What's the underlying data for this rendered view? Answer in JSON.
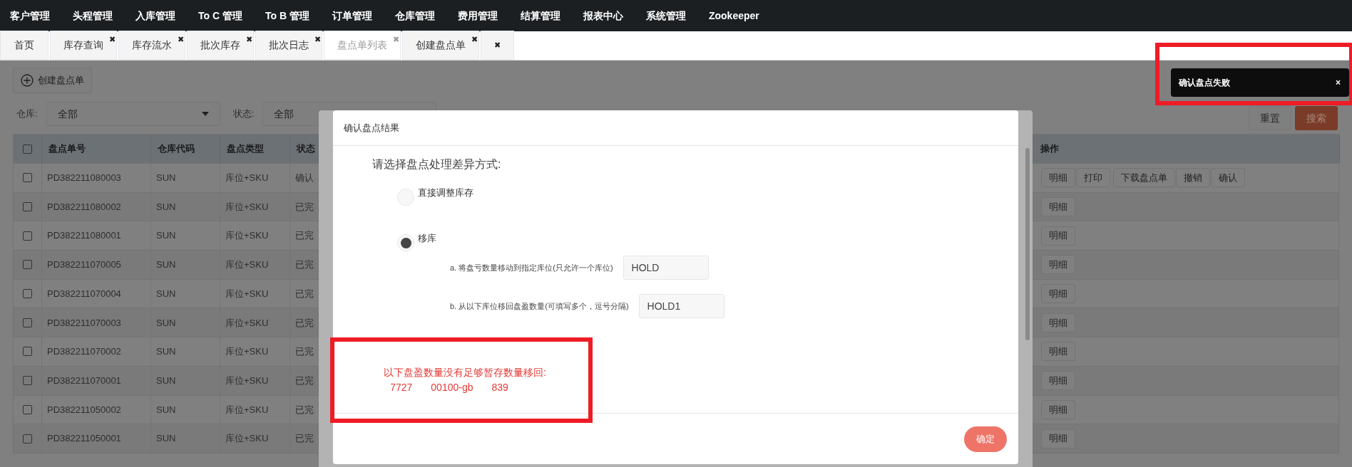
{
  "nav": [
    "客户管理",
    "头程管理",
    "入库管理",
    "To C 管理",
    "To B 管理",
    "订单管理",
    "仓库管理",
    "费用管理",
    "结算管理",
    "报表中心",
    "系统管理",
    "Zookeeper"
  ],
  "tabs": [
    {
      "label": "首页",
      "selected": false
    },
    {
      "label": "库存查询",
      "close": "✖",
      "selected": false
    },
    {
      "label": "库存流水",
      "close": "✖",
      "selected": false
    },
    {
      "label": "批次库存",
      "close": "✖",
      "selected": false
    },
    {
      "label": "批次日志",
      "close": "✖",
      "selected": false
    },
    {
      "label": "盘点单列表",
      "close": "✖",
      "selected": true
    },
    {
      "label": "创建盘点单",
      "close": "✖",
      "selected": false
    },
    {
      "close": "✖",
      "selected": false
    }
  ],
  "create_button": "创建盘点单",
  "filters": [
    {
      "label": "仓库:",
      "value": "全部"
    },
    {
      "label": "状态:",
      "value": "全部"
    }
  ],
  "reset_button": "重置",
  "search_button": "搜索",
  "table": {
    "header_checked": false,
    "columns": [
      "盘点单号",
      "仓库代码",
      "盘点类型",
      "状态",
      "操作"
    ],
    "rows": [
      {
        "checked": false,
        "cells": [
          "PD382211080003",
          "SUN",
          "库位+SKU",
          "确认"
        ],
        "actions": [
          "明细",
          "打印",
          "下载盘点单",
          "撤销",
          "确认"
        ]
      },
      {
        "checked": false,
        "cells": [
          "PD382211080002",
          "SUN",
          "库位+SKU",
          "已完"
        ],
        "actions": [
          "明细"
        ]
      },
      {
        "checked": false,
        "cells": [
          "PD382211080001",
          "SUN",
          "库位+SKU",
          "已完"
        ],
        "actions": [
          "明细"
        ]
      },
      {
        "checked": false,
        "cells": [
          "PD382211070005",
          "SUN",
          "库位+SKU",
          "已完"
        ],
        "actions": [
          "明细"
        ]
      },
      {
        "checked": false,
        "cells": [
          "PD382211070004",
          "SUN",
          "库位+SKU",
          "已完"
        ],
        "actions": [
          "明细"
        ]
      },
      {
        "checked": false,
        "cells": [
          "PD382211070003",
          "SUN",
          "库位+SKU",
          "已完"
        ],
        "actions": [
          "明细"
        ]
      },
      {
        "checked": false,
        "cells": [
          "PD382211070002",
          "SUN",
          "库位+SKU",
          "已完"
        ],
        "actions": [
          "明细"
        ]
      },
      {
        "checked": false,
        "cells": [
          "PD382211070001",
          "SUN",
          "库位+SKU",
          "已完"
        ],
        "actions": [
          "明细"
        ]
      },
      {
        "checked": false,
        "cells": [
          "PD382211050002",
          "SUN",
          "库位+SKU",
          "已完"
        ],
        "actions": [
          "明细"
        ]
      },
      {
        "checked": false,
        "cells": [
          "PD382211050001",
          "SUN",
          "库位+SKU",
          "已完"
        ],
        "actions": [
          "明细"
        ]
      }
    ]
  },
  "dialog": {
    "title": "确认盘点结果",
    "prompt": "请选择盘点处理差异方式:",
    "options": [
      {
        "label": "直接调整库存",
        "selected": false
      },
      {
        "label": "移库",
        "selected": true
      }
    ],
    "fields": [
      {
        "label": "a. 将盘亏数量移动到指定库位(只允许一个库位)",
        "value": "HOLD"
      },
      {
        "label": "b. 从以下库位移回盘盈数量(可填写多个，逗号分隔)",
        "value": "HOLD1"
      }
    ],
    "error": {
      "message": "以下盘盈数量没有足够暂存数量移回:",
      "items": [
        "7727",
        "00100-gb",
        "839"
      ]
    },
    "confirm_button": "确定"
  },
  "toast": {
    "message": "确认盘点失败",
    "close": "×"
  }
}
